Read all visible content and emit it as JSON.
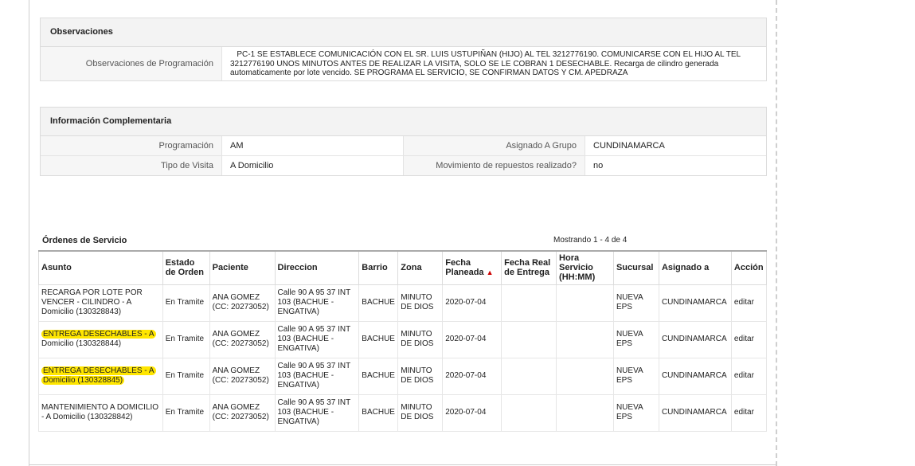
{
  "observaciones": {
    "title": "Observaciones",
    "label": "Observaciones de Programación",
    "text_part1": "PC-1 SE ESTABLECE COMUNICACIÓN CON EL SR. LUIS USTUPIÑAN (HIJO) AL TEL 3212776190. COMUNICARSE CON EL HIJO AL TEL 3212776190 UNOS MINUTOS ANTES DE REALIZAR LA VISITA, SOLO SE LE COBRAN 1 DESECHABLE. Recarga de cilindro generada automaticamente por lote vencido. SE PROGRAMA EL SERVICIO, SE CONFIRMAN DATOS Y CM. APEDRAZA"
  },
  "complementaria": {
    "title": "Información Complementaria",
    "programacion_label": "Programación",
    "programacion_value": "AM",
    "grupo_label": "Asignado A Grupo",
    "grupo_value": "CUNDINAMARCA",
    "visita_label": "Tipo de Visita",
    "visita_value": "A Domicilio",
    "repuestos_label": "Movimiento de repuestos realizado?",
    "repuestos_value": "no"
  },
  "ordenes": {
    "title": "Órdenes de Servicio",
    "showing": "Mostrando 1 - 4 de 4",
    "headers": {
      "asunto": "Asunto",
      "estado": "Estado de Orden",
      "paciente": "Paciente",
      "direccion": "Direccion",
      "barrio": "Barrio",
      "zona": "Zona",
      "fecha_planeada": "Fecha Planeada",
      "fecha_real": "Fecha Real de Entrega",
      "hora": "Hora Servicio (HH:MM)",
      "sucursal": "Sucursal",
      "asignado": "Asignado a",
      "accion": "Acción"
    },
    "rows": [
      {
        "asunto": "RECARGA POR LOTE POR VENCER - CILINDRO - A Domicilio (130328843)",
        "estado": "En Tramite",
        "paciente": "ANA GOMEZ (CC: 20273052)",
        "direccion": "Calle 90 A 95 37 INT 103 (BACHUE - ENGATIVA)",
        "barrio": "BACHUE",
        "zona": "MINUTO DE DIOS",
        "fecha_planeada": "2020-07-04",
        "fecha_real": "",
        "hora": "",
        "sucursal": "NUEVA EPS",
        "asignado": "CUNDINAMARCA",
        "accion": "editar"
      },
      {
        "asunto_hl": "ENTREGA DESECHABLES - A",
        "asunto_rest": "Domicilio (130328844)",
        "estado": "En Tramite",
        "paciente": "ANA GOMEZ (CC: 20273052)",
        "direccion": "Calle 90 A 95 37 INT 103 (BACHUE - ENGATIVA)",
        "barrio": "BACHUE",
        "zona": "MINUTO DE DIOS",
        "fecha_planeada": "2020-07-04",
        "fecha_real": "",
        "hora": "",
        "sucursal": "NUEVA EPS",
        "asignado": "CUNDINAMARCA",
        "accion": "editar"
      },
      {
        "asunto_hl": "ENTREGA DESECHABLES - A",
        "asunto_rest": "Domicilio (130328845)",
        "estado": "En Tramite",
        "paciente": "ANA GOMEZ (CC: 20273052)",
        "direccion": "Calle 90 A 95 37 INT 103 (BACHUE - ENGATIVA)",
        "barrio": "BACHUE",
        "zona": "MINUTO DE DIOS",
        "fecha_planeada": "2020-07-04",
        "fecha_real": "",
        "hora": "",
        "sucursal": "NUEVA EPS",
        "asignado": "CUNDINAMARCA",
        "accion": "editar"
      },
      {
        "asunto": "MANTENIMIENTO A DOMICILIO - A Domicilio (130328842)",
        "estado": "En Tramite",
        "paciente": "ANA GOMEZ (CC: 20273052)",
        "direccion": "Calle 90 A 95 37 INT 103 (BACHUE - ENGATIVA)",
        "barrio": "BACHUE",
        "zona": "MINUTO DE DIOS",
        "fecha_planeada": "2020-07-04",
        "fecha_real": "",
        "hora": "",
        "sucursal": "NUEVA EPS",
        "asignado": "CUNDINAMARCA",
        "accion": "editar"
      }
    ]
  }
}
